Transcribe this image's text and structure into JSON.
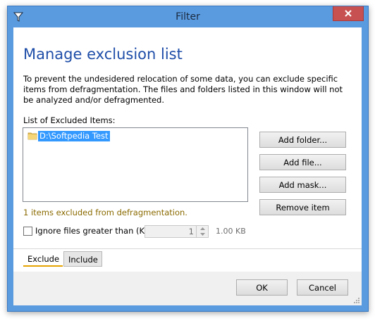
{
  "window": {
    "title": "Filter",
    "accent_color": "#5a9be0",
    "close_color": "#c75050"
  },
  "heading": "Manage exclusion list",
  "description": "To prevent the undesidered relocation of some data, you can exclude specific items from defragmentation. The files and folders listed in this window will not be analyzed and/or defragmented.",
  "list": {
    "label": "List of Excluded Items:",
    "items": [
      {
        "icon": "folder-icon",
        "path": "D:\\Softpedia Test",
        "selected": true
      }
    ]
  },
  "buttons": {
    "add_folder": "Add folder...",
    "add_file": "Add file...",
    "add_mask": "Add mask...",
    "remove_item": "Remove item",
    "ok": "OK",
    "cancel": "Cancel"
  },
  "status": "1 items excluded from defragmentation.",
  "ignore": {
    "label": "Ignore files greater than (KB):",
    "checked": false,
    "value": "1",
    "size_text": "1.00 KB"
  },
  "tabs": {
    "exclude": "Exclude",
    "include": "Include",
    "active": "Exclude"
  }
}
